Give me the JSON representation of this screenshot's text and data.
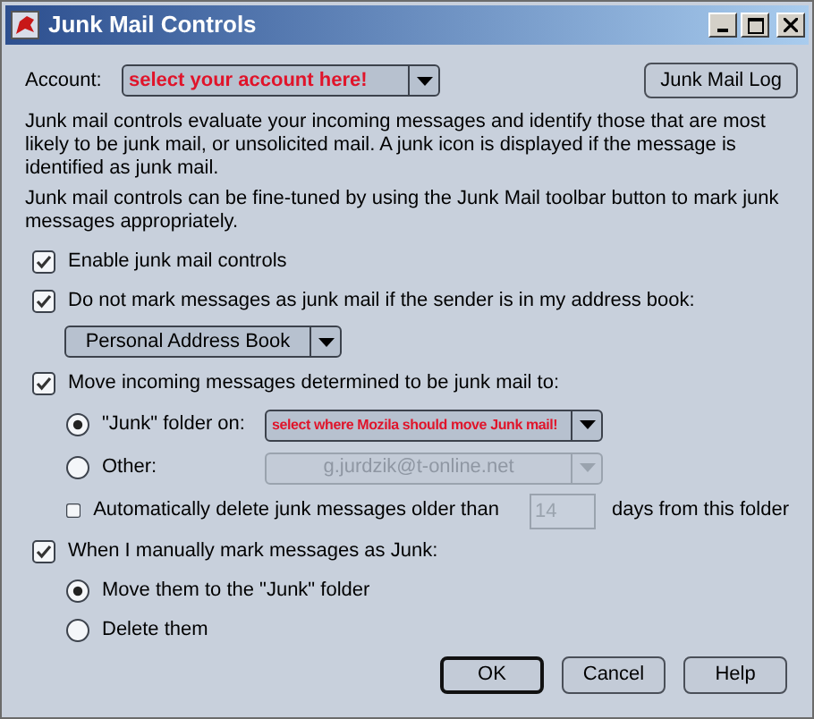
{
  "window": {
    "title": "Junk Mail Controls"
  },
  "account": {
    "label": "Account:",
    "value": "select your account here!",
    "emphasis": true
  },
  "log_button": {
    "label": "Junk Mail Log"
  },
  "paragraphs": [
    "Junk mail controls evaluate your incoming messages and identify those that are most likely to be junk mail, or unsolicited mail. A junk icon is displayed if the message is identified as junk mail.",
    "Junk mail controls can be fine-tuned by using the Junk Mail toolbar button to mark junk messages appropriately."
  ],
  "settings": [
    {
      "kind": "checkbox",
      "label": "Enable junk mail controls",
      "checked": true
    },
    {
      "kind": "checkbox",
      "label": "Do not mark messages as junk mail if the sender is in my address book:",
      "checked": true,
      "children": [
        {
          "kind": "dropdown",
          "value": "Personal Address Book",
          "emphasis": false,
          "disabled": false
        }
      ]
    },
    {
      "kind": "checkbox",
      "label": "Move incoming messages determined to be junk mail to:",
      "checked": true,
      "children": [
        {
          "kind": "radio",
          "label": "\"Junk\" folder on:",
          "selected": true,
          "dropdown": {
            "value": "select where Mozila should move Junk mail!",
            "emphasis": true,
            "disabled": false
          }
        },
        {
          "kind": "radio",
          "label": "Other:",
          "selected": false,
          "dropdown": {
            "value": "g.jurdzik@t-online.net",
            "emphasis": false,
            "disabled": true
          }
        },
        {
          "kind": "checkbox",
          "label": "Automatically delete junk messages older than",
          "checked": false,
          "field": {
            "value": "14",
            "disabled": true
          },
          "suffix": "days from this folder"
        }
      ]
    },
    {
      "kind": "checkbox",
      "label": "When I manually mark messages as Junk:",
      "checked": true,
      "children": [
        {
          "kind": "radio",
          "label": "Move them to the \"Junk\" folder",
          "selected": true
        },
        {
          "kind": "radio",
          "label": "Delete them",
          "selected": false
        }
      ]
    }
  ],
  "buttons": [
    {
      "label": "OK",
      "default": true
    },
    {
      "label": "Cancel",
      "default": false
    },
    {
      "label": "Help",
      "default": false
    }
  ]
}
